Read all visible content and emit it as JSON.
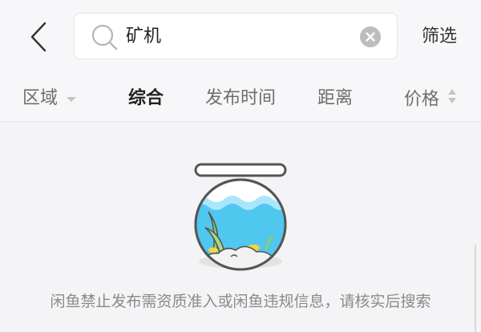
{
  "header": {
    "back_icon": "chevron-left-icon",
    "search_value": "矿机",
    "search_icon": "search-icon",
    "clear_icon": "clear-circle-icon",
    "filter_label": "筛选"
  },
  "tabs": [
    {
      "label": "区域",
      "icon": "caret-down-icon"
    },
    {
      "label": "综合",
      "active": true
    },
    {
      "label": "发布时间"
    },
    {
      "label": "距离"
    },
    {
      "label": "价格",
      "icon": "sort-icon"
    }
  ],
  "empty_state": {
    "illustration": "fishbowl-icon",
    "message": "闲鱼禁止发布需资质准入或闲鱼违规信息，请核实后搜索"
  },
  "colors": {
    "background": "#f4f4f6",
    "water": "#4fc7ee",
    "text_muted": "#8a8a8a"
  }
}
